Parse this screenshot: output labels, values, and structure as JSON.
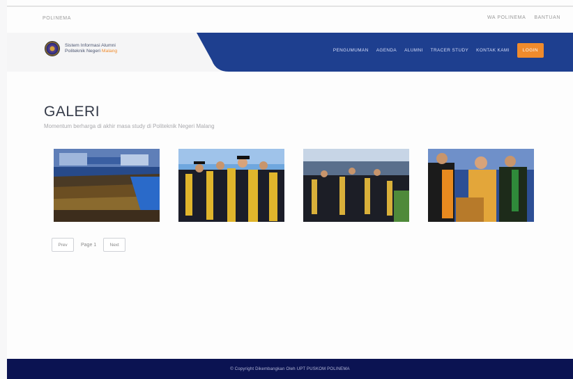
{
  "topbar": {
    "brand": "POLINEMA",
    "links": [
      "WA POLINEMA",
      "BANTUAN"
    ]
  },
  "header": {
    "logo_line1": "Sistem Informasi Alumni",
    "logo_line2_prefix": "Politeknik Negeri ",
    "logo_line2_highlight": "Malang",
    "nav": [
      "PENGUMUMAN",
      "AGENDA",
      "ALUMNI",
      "TRACER STUDY",
      "KONTAK KAMI"
    ],
    "login_label": "LOGIN",
    "colors": {
      "nav_bg": "#1e3f8f",
      "accent": "#f08b2c"
    }
  },
  "main": {
    "title": "GALERI",
    "subtitle": "Momentum berharga di akhir masa study di Politeknik Negeri Malang",
    "pager": {
      "prev": "Prev",
      "page_label": "Page 1",
      "next": "Next"
    }
  },
  "footer": {
    "text": "© Copyright Dikembangkan Oleh UPT PUSKOM POLINEMA"
  }
}
